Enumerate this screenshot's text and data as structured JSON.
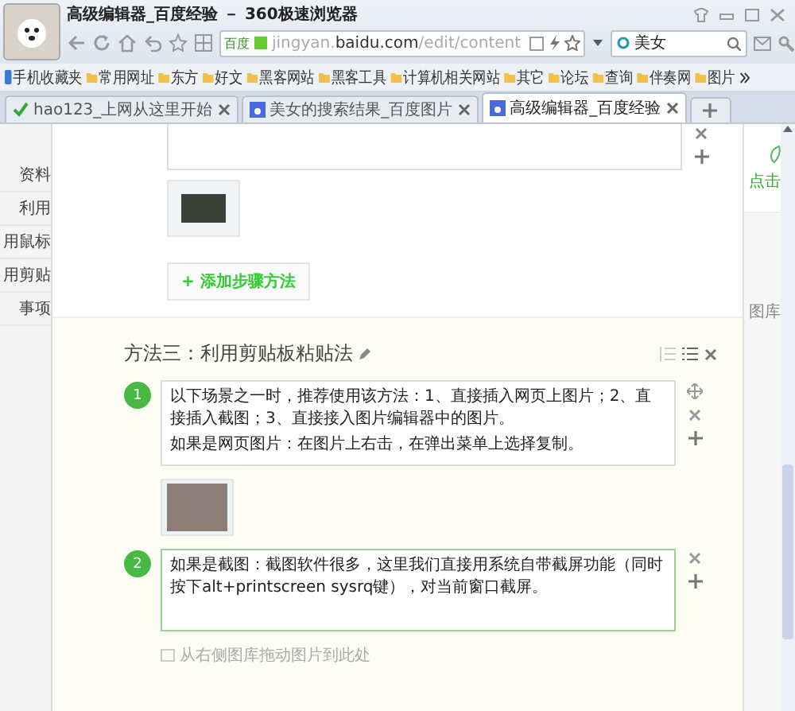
{
  "window": {
    "title": "高级编辑器_百度经验 － 360极速浏览器"
  },
  "toolbar": {
    "address_badge": "百度",
    "address": "jingyan.**baidu.com**/edit/content",
    "search_value": "美女"
  },
  "bookmarks": [
    {
      "label": "手机收藏夹",
      "kind": "phone"
    },
    {
      "label": "常用网址",
      "kind": "folder"
    },
    {
      "label": "东方",
      "kind": "folder"
    },
    {
      "label": "好文",
      "kind": "folder"
    },
    {
      "label": "黑客网站",
      "kind": "folder"
    },
    {
      "label": "黑客工具",
      "kind": "folder"
    },
    {
      "label": "计算机相关网站",
      "kind": "folder"
    },
    {
      "label": "其它",
      "kind": "folder"
    },
    {
      "label": "论坛",
      "kind": "folder"
    },
    {
      "label": "查询",
      "kind": "folder"
    },
    {
      "label": "伴奏网",
      "kind": "folder"
    },
    {
      "label": "图片",
      "kind": "folder"
    }
  ],
  "tabs": [
    {
      "label": "hao123_上网从这里开始",
      "selected": false
    },
    {
      "label": "美女的搜索结果_百度图片",
      "selected": false
    },
    {
      "label": "高级编辑器_百度经验",
      "selected": true
    }
  ],
  "sidebar": {
    "items": [
      {
        "label": "资料"
      },
      {
        "label": "利用"
      },
      {
        "label": "用鼠标"
      },
      {
        "label": "用剪贴"
      },
      {
        "label": "事项"
      }
    ]
  },
  "editor": {
    "add_step": "+ 添加步骤方法",
    "method_title": "方法三：利用剪贴板粘贴法",
    "steps": [
      {
        "number": "1",
        "paragraphs": [
          "以下场景之一时，推荐使用该方法：1、直接插入网页上图片；2、直接插入截图；3、直接接入图片编辑器中的图片。",
          "如果是网页图片：在图片上右击，在弹出菜单上选择复制。"
        ],
        "focused": false
      },
      {
        "number": "2",
        "paragraphs": [
          "如果是截图：截图软件很多，这里我们直接用系统自带截屏功能（同时按下alt+printscreen sysrq键），对当前窗口截屏。"
        ],
        "focused": true
      }
    ],
    "drop_hint": "从右侧图库拖动图片到此处"
  },
  "right_panel": {
    "label": "点击",
    "gallery_label": "图库"
  }
}
